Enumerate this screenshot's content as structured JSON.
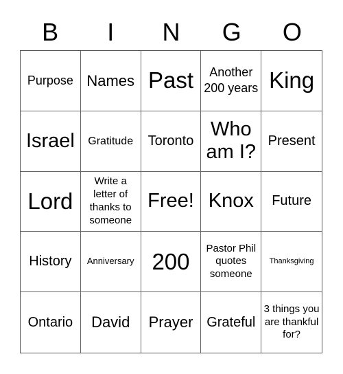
{
  "header": {
    "letters": [
      "B",
      "I",
      "N",
      "G",
      "O"
    ]
  },
  "cells": [
    [
      "Purpose",
      "Names",
      "Past",
      "Another 200 years",
      "King"
    ],
    [
      "Israel",
      "Gratitude",
      "Toronto",
      "Who am I?",
      "Present"
    ],
    [
      "Lord",
      "Write a letter of thanks to someone",
      "Free!",
      "Knox",
      "Future"
    ],
    [
      "History",
      "Anniversary",
      "200",
      "Pastor Phil quotes someone",
      "Thanksgiving"
    ],
    [
      "Ontario",
      "David",
      "Prayer",
      "Grateful",
      "3 things you are thankful for?"
    ]
  ]
}
